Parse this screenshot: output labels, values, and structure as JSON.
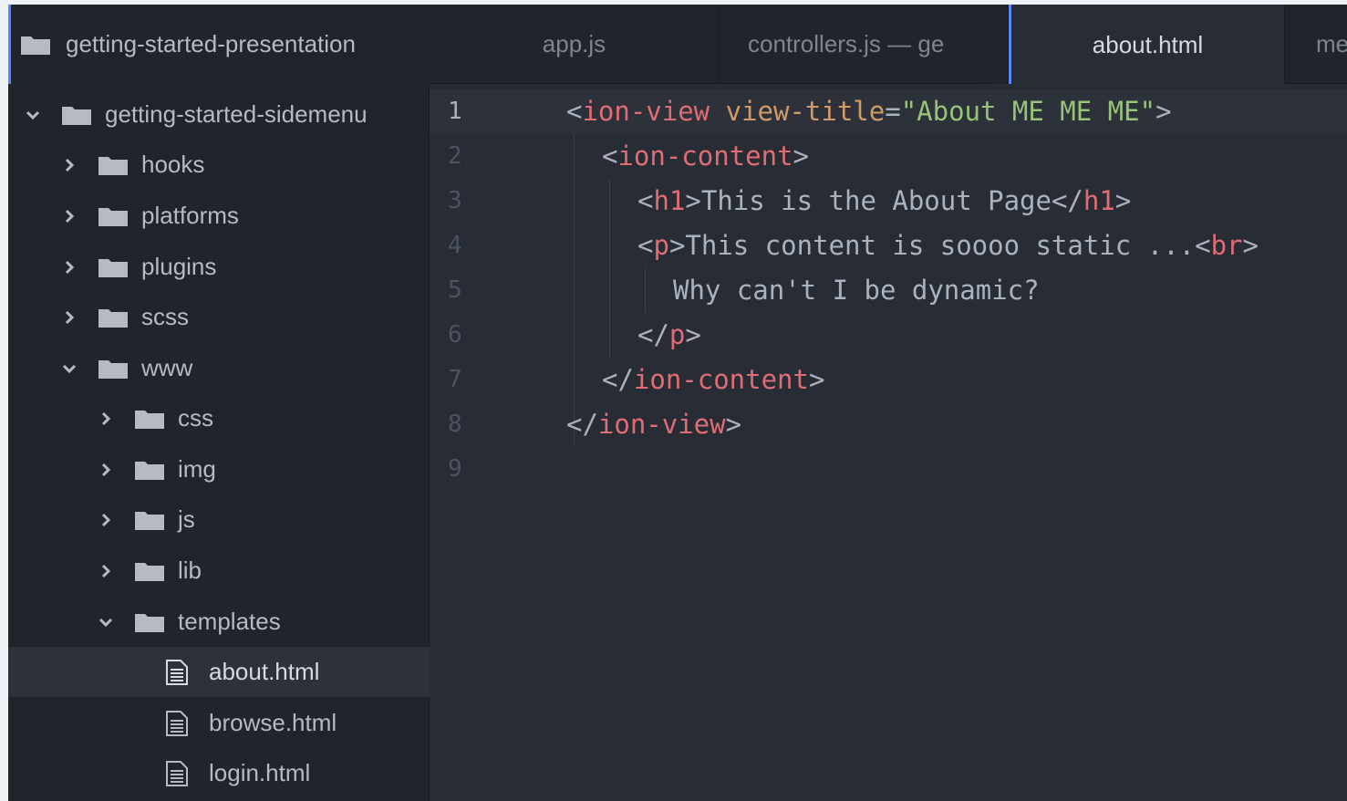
{
  "window": {
    "project_title": "getting-started-presentation"
  },
  "tabs": [
    {
      "label": "app.js",
      "active": false
    },
    {
      "label": "controllers.js — ge",
      "active": false
    },
    {
      "label": "about.html",
      "active": true
    },
    {
      "label": "me",
      "active": false
    }
  ],
  "tree": {
    "root": "getting-started-sidemenu",
    "items": [
      {
        "label": "hooks",
        "type": "folder",
        "expanded": false
      },
      {
        "label": "platforms",
        "type": "folder",
        "expanded": false
      },
      {
        "label": "plugins",
        "type": "folder",
        "expanded": false
      },
      {
        "label": "scss",
        "type": "folder",
        "expanded": false
      },
      {
        "label": "www",
        "type": "folder",
        "expanded": true
      },
      {
        "label": "css",
        "type": "folder",
        "expanded": false
      },
      {
        "label": "img",
        "type": "folder",
        "expanded": false
      },
      {
        "label": "js",
        "type": "folder",
        "expanded": false
      },
      {
        "label": "lib",
        "type": "folder",
        "expanded": false
      },
      {
        "label": "templates",
        "type": "folder",
        "expanded": true
      },
      {
        "label": "about.html",
        "type": "file",
        "selected": true
      },
      {
        "label": "browse.html",
        "type": "file"
      },
      {
        "label": "login.html",
        "type": "file"
      }
    ]
  },
  "editor": {
    "current_line": 1,
    "line_numbers": [
      "1",
      "2",
      "3",
      "4",
      "5",
      "6",
      "7",
      "8",
      "9"
    ],
    "lines": [
      [
        [
          "t-pun",
          "<"
        ],
        [
          "t-tag",
          "ion-view"
        ],
        [
          "t-pun",
          " "
        ],
        [
          "t-attr",
          "view-title"
        ],
        [
          "t-pun",
          "="
        ],
        [
          "t-str",
          "\"About ME ME ME\""
        ],
        [
          "t-pun",
          ">"
        ]
      ],
      [
        [
          "t-pun",
          "<"
        ],
        [
          "t-tag",
          "ion-content"
        ],
        [
          "t-pun",
          ">"
        ]
      ],
      [
        [
          "t-pun",
          "<"
        ],
        [
          "t-tag",
          "h1"
        ],
        [
          "t-pun",
          ">"
        ],
        [
          "t-txt",
          "This is the About Page"
        ],
        [
          "t-pun",
          "</"
        ],
        [
          "t-tag",
          "h1"
        ],
        [
          "t-pun",
          ">"
        ]
      ],
      [
        [
          "t-pun",
          "<"
        ],
        [
          "t-tag",
          "p"
        ],
        [
          "t-pun",
          ">"
        ],
        [
          "t-txt",
          "This content is soooo static ..."
        ],
        [
          "t-pun",
          "<"
        ],
        [
          "t-tag",
          "br"
        ],
        [
          "t-pun",
          ">"
        ]
      ],
      [
        [
          "t-txt",
          "Why can't I be dynamic?"
        ]
      ],
      [
        [
          "t-pun",
          "</"
        ],
        [
          "t-tag",
          "p"
        ],
        [
          "t-pun",
          ">"
        ]
      ],
      [
        [
          "t-pun",
          "</"
        ],
        [
          "t-tag",
          "ion-content"
        ],
        [
          "t-pun",
          ">"
        ]
      ],
      [
        [
          "t-pun",
          "</"
        ],
        [
          "t-tag",
          "ion-view"
        ],
        [
          "t-pun",
          ">"
        ]
      ],
      []
    ]
  },
  "colors": {
    "tag": "#e06c75",
    "attribute": "#d19a66",
    "string": "#98c379",
    "accent": "#568af2"
  }
}
